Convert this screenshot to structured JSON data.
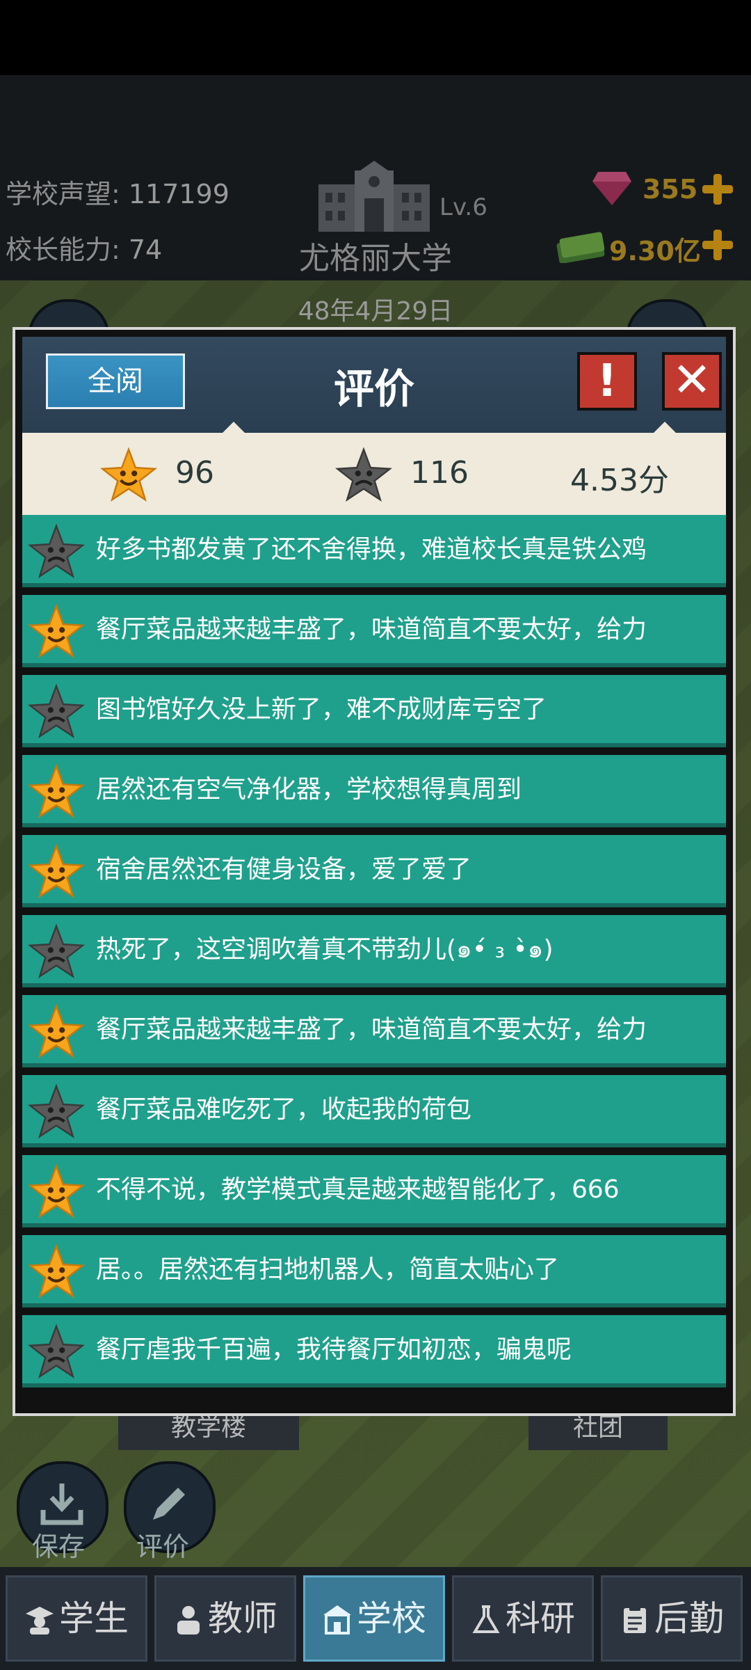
{
  "hud": {
    "reputation_label": "学校声望:",
    "reputation_value": "117199",
    "ability_label": "校长能力:",
    "ability_value": "74",
    "school_level": "Lv.6",
    "school_name": "尤格丽大学",
    "date": "48年4月29日",
    "gems": "355",
    "money": "9.30亿",
    "gem_icon": "gem-icon",
    "money_icon": "cash-stack-icon"
  },
  "dialog": {
    "read_all_label": "全阅",
    "title": "评价",
    "alert_glyph": "!",
    "close_glyph": "✕",
    "summary": {
      "good_count": "96",
      "bad_count": "116",
      "score": "4.53分"
    },
    "reviews": [
      {
        "mood": "bad",
        "text": "好多书都发黄了还不舍得换，难道校长真是铁公鸡"
      },
      {
        "mood": "good",
        "text": "餐厅菜品越来越丰盛了，味道简直不要太好，给力"
      },
      {
        "mood": "bad",
        "text": "图书馆好久没上新了，难不成财库亏空了"
      },
      {
        "mood": "good",
        "text": "居然还有空气净化器，学校想得真周到"
      },
      {
        "mood": "good",
        "text": "宿舍居然还有健身设备，爱了爱了"
      },
      {
        "mood": "bad",
        "text": "热死了，这空调吹着真不带劲儿(๑•́ ₃ •̀๑)"
      },
      {
        "mood": "good",
        "text": "餐厅菜品越来越丰盛了，味道简直不要太好，给力"
      },
      {
        "mood": "bad",
        "text": "餐厅菜品难吃死了，收起我的荷包"
      },
      {
        "mood": "good",
        "text": "不得不说，教学模式真是越来越智能化了，666"
      },
      {
        "mood": "good",
        "text": "居。。居然还有扫地机器人，简直太贴心了"
      },
      {
        "mood": "bad",
        "text": "餐厅虐我千百遍，我待餐厅如初恋，骗鬼呢"
      }
    ]
  },
  "background": {
    "teaching_building_label": "教学楼",
    "club_label": "社团",
    "save_label": "保存",
    "review_label": "评价"
  },
  "nav": {
    "students": "学生",
    "teachers": "教师",
    "school": "学校",
    "research": "科研",
    "logistics": "后勤"
  },
  "colors": {
    "row_bg": "#1fa08c",
    "star_good": "#f7a51c",
    "star_bad": "#5a5a5a",
    "close_red": "#c23a2f"
  }
}
